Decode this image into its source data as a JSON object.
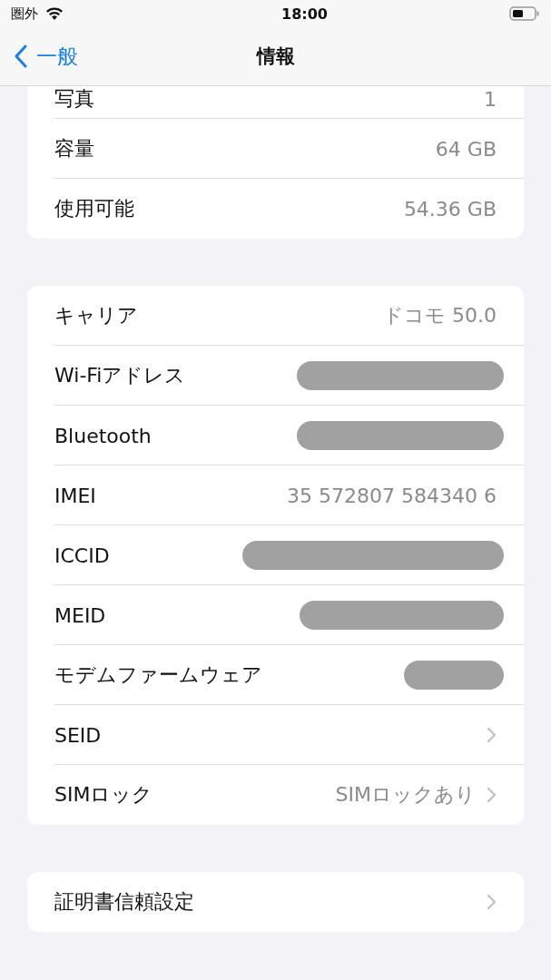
{
  "status_bar": {
    "carrier": "圏外",
    "time": "18:00"
  },
  "nav": {
    "back": "一般",
    "title": "情報"
  },
  "sections": [
    {
      "short_first": true,
      "rows": [
        {
          "label": "写真",
          "kind": "text",
          "value": "1"
        },
        {
          "label": "容量",
          "kind": "text",
          "value": "64 GB"
        },
        {
          "label": "使用可能",
          "kind": "text",
          "value": "54.36 GB"
        }
      ]
    },
    {
      "rows": [
        {
          "label": "キャリア",
          "kind": "text",
          "value": "ドコモ 50.0"
        },
        {
          "label": "Wi-Fiアドレス",
          "kind": "redacted"
        },
        {
          "label": "Bluetooth",
          "kind": "redacted"
        },
        {
          "label": "IMEI",
          "kind": "text",
          "value": "35 572807 584340 6"
        },
        {
          "label": "ICCID",
          "kind": "redacted"
        },
        {
          "label": "MEID",
          "kind": "redacted"
        },
        {
          "label": "モデムファームウェア",
          "kind": "redacted"
        },
        {
          "label": "SEID",
          "kind": "link"
        },
        {
          "label": "SIMロック",
          "kind": "link",
          "value": "SIMロックあり"
        }
      ]
    },
    {
      "rows": [
        {
          "label": "証明書信頼設定",
          "kind": "link"
        }
      ]
    }
  ]
}
